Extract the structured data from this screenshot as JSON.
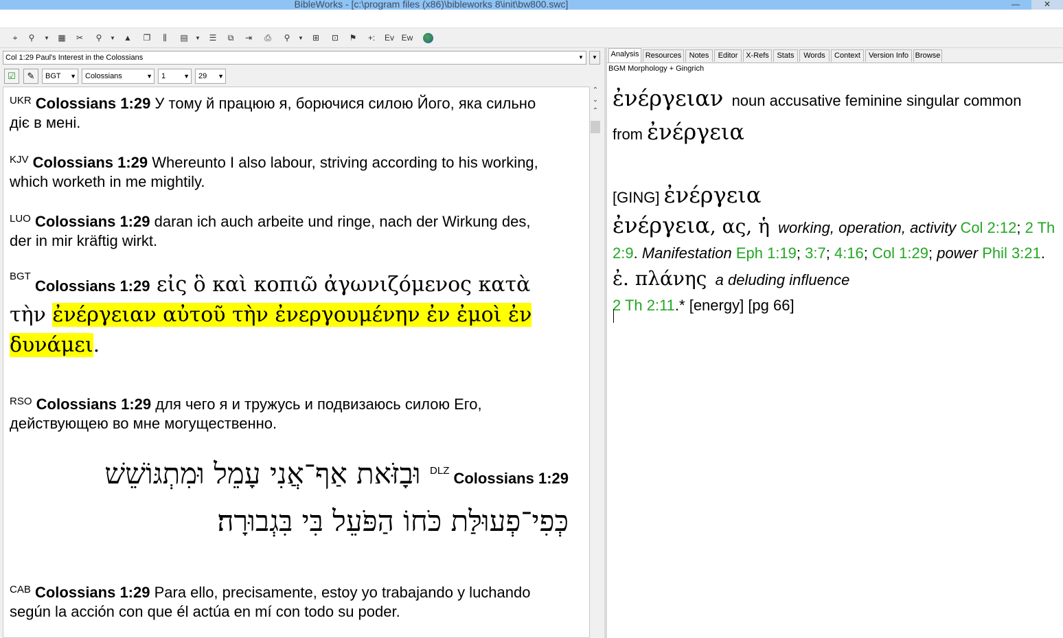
{
  "window": {
    "title": "BibleWorks - [c:\\program files (x86)\\bibleworks 8\\init\\bw800.swc]",
    "minimize": "—",
    "close": "✕"
  },
  "toolbar": {
    "icons": [
      "move-icon",
      "target-icon",
      "search-person-icon",
      "grid-icon",
      "tools-icon",
      "search-icon",
      "window-icon",
      "columns-icon",
      "table-icon",
      "list-icon",
      "copy-icon",
      "export-icon",
      "print-icon",
      "analysis-icon",
      "layout-icon",
      "text-icon",
      "flag-icon",
      "plus-icon",
      "ev-icon",
      "ew-icon",
      "globe-icon"
    ],
    "labels": {
      "plus": "+:",
      "ev": "Ev",
      "ew": "Ew"
    }
  },
  "left": {
    "verse_combo": "Col 1:29 Paul's Interest in the Colossians",
    "version": "BGT",
    "book": "Colossians",
    "chapter": "1",
    "verse_num": "29",
    "verses": [
      {
        "label": "UKR",
        "ref": "Colossians 1:29",
        "text": " У тому й працюю я, борючися силою Його, яка сильно діє в мені."
      },
      {
        "label": "KJV",
        "ref": "Colossians 1:29",
        "text": " Whereunto I also labour, striving according to his working, which worketh in me mightily."
      },
      {
        "label": "LUO",
        "ref": "Colossians 1:29",
        "text": " daran ich auch arbeite und ringe, nach der Wirkung des, der in mir kräftig wirkt."
      },
      {
        "label": "BGT",
        "ref": "Colossians 1:29",
        "text_plain": " εἰς ὃ καὶ κοπιῶ ἀγωνιζόμενος κατὰ τὴν ",
        "text_highlight": "ἐνέργειαν αὐτοῦ τὴν ἐνεργουμένην ἐν ἐμοὶ ἐν δυνάμει",
        "text_end": "."
      },
      {
        "label": "RSO",
        "ref": "Colossians 1:29",
        "text": " для чего я и тружусь и подвизаюсь силою Его, действующею во мне могущественно."
      },
      {
        "label": "DLZ",
        "ref": "Colossians 1:29",
        "text": "וּבָזֹּאת אַף־אֲנִי עָמֵל וּמִתְגּוֹשֵׁשׁ כְּפִי־פְעוּלַּת כֹּחוֹ הַפֹּעֵל בִּי בִּגְבוּרָה׃"
      },
      {
        "label": "CAB",
        "ref": "Colossians 1:29",
        "text": " Para ello, precisamente, estoy yo trabajando y luchando según la acción con que él actúa en mí con todo su poder."
      }
    ]
  },
  "right": {
    "tabs": [
      "Analysis",
      "Resources",
      "Notes",
      "Editor",
      "X-Refs",
      "Stats",
      "Words",
      "Context",
      "Version Info",
      "Browse"
    ],
    "resource_title": "BGM Morphology + Gingrich",
    "word": "ἐνέργειαν",
    "parse": "noun accusative feminine singular common",
    "from_label": "from",
    "lemma": "ἐνέργεια",
    "ging_tag": "[GING]",
    "ging_lemma": "ἐνέργεια",
    "entry_head": "ἐνέργεια",
    "entry_forms": ", ας, ἡ",
    "gloss1": "working, operation, activity",
    "ref_col212": "Col 2:12",
    "ref_2th29": "2 Th 2:9",
    "gloss2": "Manifestation",
    "ref_eph119": "Eph 1:19",
    "ref_37": "3:7",
    "ref_416": "4:16",
    "ref_col129": "Col 1:29",
    "gloss3": "power",
    "ref_phil321": "Phil 3:21",
    "abbr": "ἐ. πλάνης",
    "gloss4": "a deluding influence",
    "ref_2th211": "2 Th 2:11",
    "tail": ".* [energy] [pg 66]"
  },
  "colors": {
    "highlight": "#ffff00",
    "link_green": "#22a722",
    "titlebar": "#8fc3f3"
  }
}
